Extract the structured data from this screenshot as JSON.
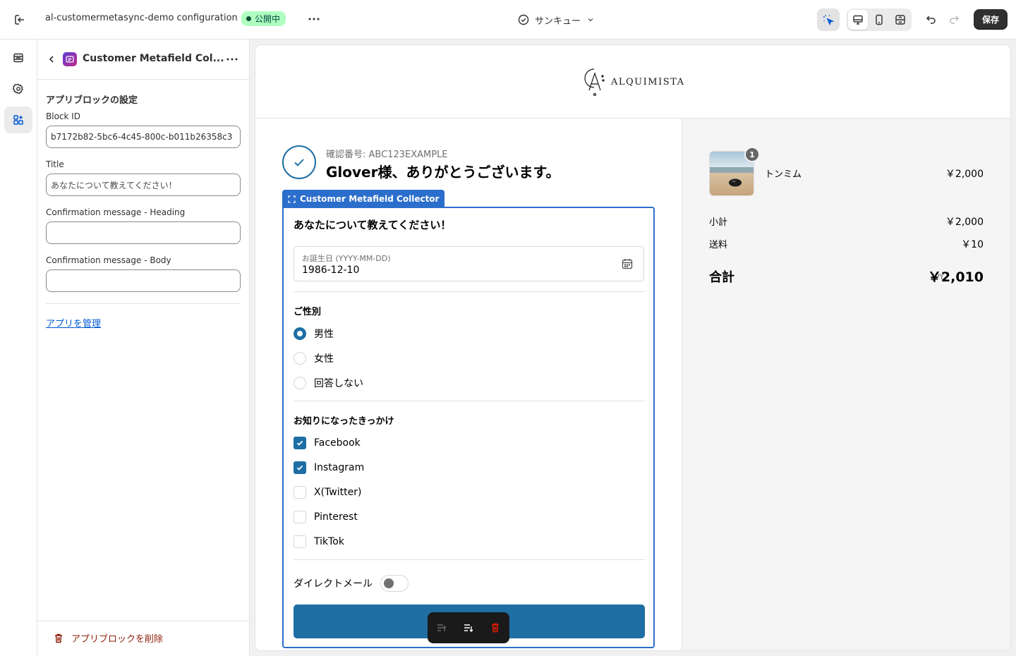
{
  "topbar": {
    "store_name": "al-customermetasync-demo configuration",
    "status_badge": "公開中",
    "page_selector": "サンキュー",
    "save_label": "保存"
  },
  "panel": {
    "title": "Customer Metafield Col...",
    "section_title": "アプリブロックの設定",
    "fields": [
      {
        "label": "Block ID",
        "value": "b7172b82-5bc6-4c45-800c-b011b26358c3"
      },
      {
        "label": "Title",
        "value": "あなたについて教えてください！"
      },
      {
        "label": "Confirmation message - Heading",
        "value": ""
      },
      {
        "label": "Confirmation message - Body",
        "value": ""
      }
    ],
    "manage_link": "アプリを管理",
    "delete_label": "アプリブロックを削除"
  },
  "store": {
    "logo_text": "ALQUIMISTA"
  },
  "thankyou": {
    "confirmation": "確認番号: ABC123EXAMPLE",
    "heading": "Glover様、ありがとうございます。"
  },
  "block": {
    "tab_label": "Customer Metafield Collector",
    "heading": "あなたについて教えてください！",
    "birthday_label": "お誕生日 (YYYY-MM-DD)",
    "birthday_value": "1986-12-10",
    "gender_title": "ご性別",
    "gender_options": [
      {
        "label": "男性",
        "selected": true
      },
      {
        "label": "女性",
        "selected": false
      },
      {
        "label": "回答しない",
        "selected": false
      }
    ],
    "source_title": "お知りになったきっかけ",
    "source_options": [
      {
        "label": "Facebook",
        "checked": true
      },
      {
        "label": "Instagram",
        "checked": true
      },
      {
        "label": "X(Twitter)",
        "checked": false
      },
      {
        "label": "Pinterest",
        "checked": false
      },
      {
        "label": "TikTok",
        "checked": false
      }
    ],
    "direct_mail_label": "ダイレクトメール",
    "direct_mail_on": false
  },
  "summary": {
    "product_name": "トンミム",
    "product_qty": "1",
    "product_price": "￥2,000",
    "subtotal_label": "小計",
    "subtotal_value": "￥2,000",
    "shipping_label": "送料",
    "shipping_value": "￥10",
    "total_label": "合計",
    "total_currency": "JPY",
    "total_value": "￥2,010"
  },
  "colors": {
    "accent": "#1f6fa5",
    "editor_blue": "#2c6ecb",
    "badge_bg": "#affebf"
  }
}
